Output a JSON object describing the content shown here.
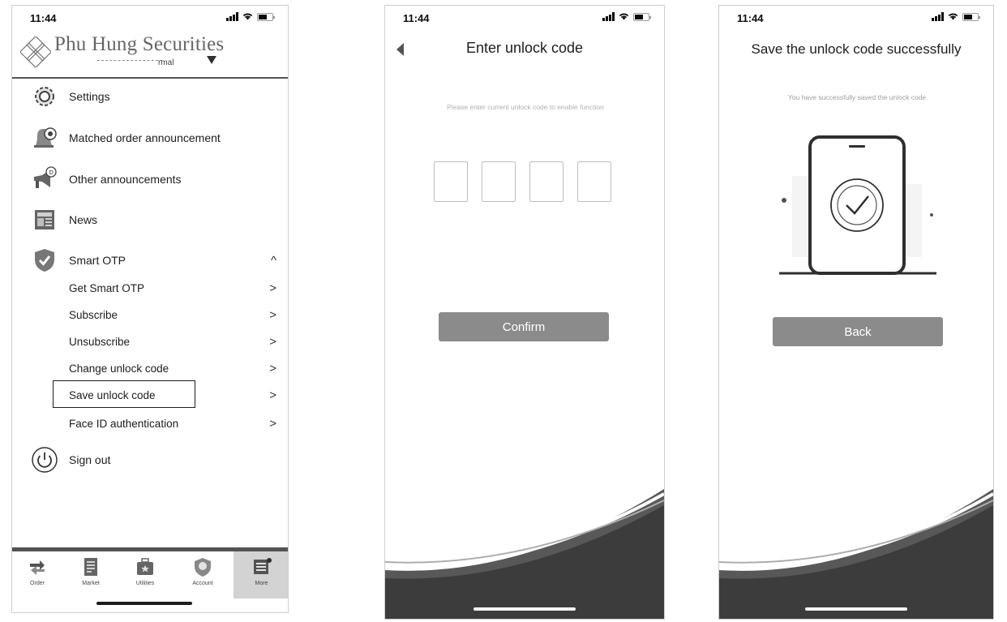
{
  "status_bar": {
    "time": "11:44"
  },
  "screen1": {
    "brand_name": "Phu Hung Securities",
    "account_suffix": "rmal",
    "menu": [
      {
        "label": "Settings",
        "icon": "gear-icon"
      },
      {
        "label": "Matched order announcement",
        "icon": "bell-icon"
      },
      {
        "label": "Other announcements",
        "icon": "megaphone-icon"
      },
      {
        "label": "News",
        "icon": "newspaper-icon"
      },
      {
        "label": "Smart OTP",
        "icon": "shield-check-icon"
      }
    ],
    "smart_otp_items": [
      {
        "label": "Get Smart OTP"
      },
      {
        "label": "Subscribe"
      },
      {
        "label": "Unsubscribe"
      },
      {
        "label": "Change unlock code"
      },
      {
        "label": "Save unlock code"
      },
      {
        "label": "Face ID authentication"
      }
    ],
    "sign_out": "Sign out",
    "tabs": [
      {
        "label": "Order",
        "icon": "order-arrows-icon"
      },
      {
        "label": "Market",
        "icon": "market-document-icon"
      },
      {
        "label": "Utilities",
        "icon": "utilities-toolbox-icon"
      },
      {
        "label": "Account",
        "icon": "account-shield-icon"
      },
      {
        "label": "More",
        "icon": "more-menu-icon"
      }
    ]
  },
  "screen2": {
    "title": "Enter unlock code",
    "hint": "Please enter current unlock code to enable function",
    "confirm_label": "Confirm"
  },
  "screen3": {
    "title": "Save the unlock code successfully",
    "message": "You have successfully saved the unlock code",
    "back_label": "Back"
  }
}
